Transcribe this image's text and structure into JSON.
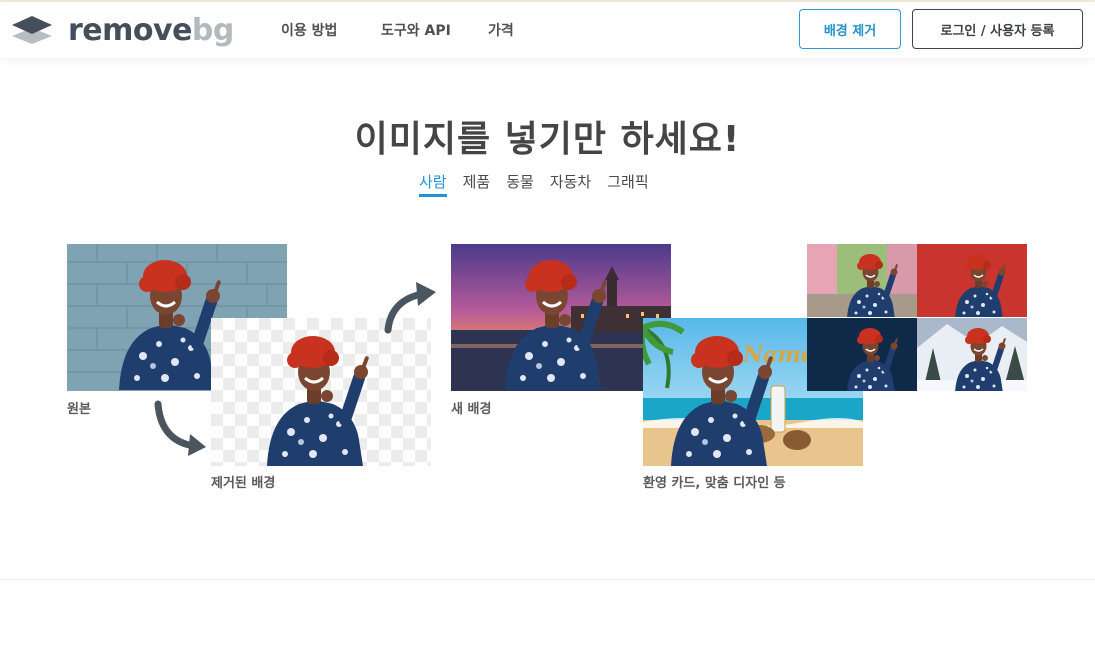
{
  "header": {
    "logo": {
      "word1": "remove",
      "word2": "bg"
    },
    "nav": [
      {
        "label": "이용 방법"
      },
      {
        "label": "도구와 API"
      },
      {
        "label": "가격"
      }
    ],
    "remove_bg_button": "배경 제거",
    "login_button": "로그인 / 사용자 등록"
  },
  "hero": {
    "title": "이미지를 넣기만 하세요!",
    "tabs": [
      {
        "label": "사람",
        "active": true
      },
      {
        "label": "제품",
        "active": false
      },
      {
        "label": "동물",
        "active": false
      },
      {
        "label": "자동차",
        "active": false
      },
      {
        "label": "그래픽",
        "active": false
      }
    ]
  },
  "examples": {
    "original_caption": "원본",
    "removed_caption": "제거된 배경",
    "new_bg_caption": "새 배경",
    "cards_caption": "환영 카드, 맞춤 디자인 등"
  },
  "colors": {
    "accent": "#2192d9",
    "text_dark": "#454545",
    "arrow": "#4b5560"
  }
}
